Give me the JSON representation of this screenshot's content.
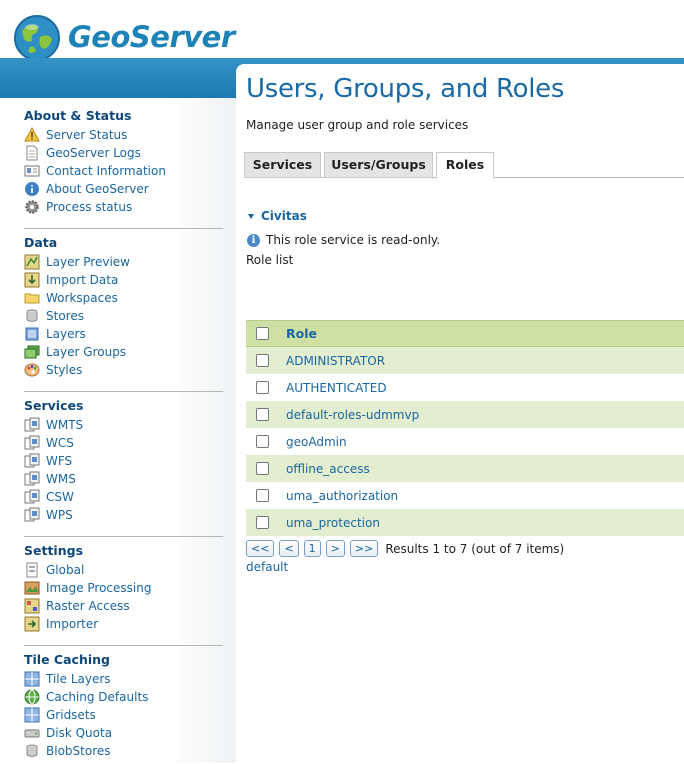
{
  "app": {
    "name": "GeoServer"
  },
  "sidebar": {
    "sections": [
      {
        "title": "About & Status",
        "items": [
          {
            "label": "Server Status",
            "icon": "warning-icon"
          },
          {
            "label": "GeoServer Logs",
            "icon": "document-icon"
          },
          {
            "label": "Contact Information",
            "icon": "contact-card-icon"
          },
          {
            "label": "About GeoServer",
            "icon": "info-circle-icon"
          },
          {
            "label": "Process status",
            "icon": "gear-icon"
          }
        ]
      },
      {
        "title": "Data",
        "items": [
          {
            "label": "Layer Preview",
            "icon": "map-preview-icon"
          },
          {
            "label": "Import Data",
            "icon": "import-icon"
          },
          {
            "label": "Workspaces",
            "icon": "folder-icon"
          },
          {
            "label": "Stores",
            "icon": "database-icon"
          },
          {
            "label": "Layers",
            "icon": "layer-icon"
          },
          {
            "label": "Layer Groups",
            "icon": "layer-group-icon"
          },
          {
            "label": "Styles",
            "icon": "palette-icon"
          }
        ]
      },
      {
        "title": "Services",
        "items": [
          {
            "label": "WMTS",
            "icon": "service-icon"
          },
          {
            "label": "WCS",
            "icon": "service-icon"
          },
          {
            "label": "WFS",
            "icon": "service-icon"
          },
          {
            "label": "WMS",
            "icon": "service-icon"
          },
          {
            "label": "CSW",
            "icon": "service-icon"
          },
          {
            "label": "WPS",
            "icon": "service-icon"
          }
        ]
      },
      {
        "title": "Settings",
        "items": [
          {
            "label": "Global",
            "icon": "settings-page-icon"
          },
          {
            "label": "Image Processing",
            "icon": "image-icon"
          },
          {
            "label": "Raster Access",
            "icon": "raster-icon"
          },
          {
            "label": "Importer",
            "icon": "importer-icon"
          }
        ]
      },
      {
        "title": "Tile Caching",
        "items": [
          {
            "label": "Tile Layers",
            "icon": "grid-icon"
          },
          {
            "label": "Caching Defaults",
            "icon": "globe-icon"
          },
          {
            "label": "Gridsets",
            "icon": "grid-icon"
          },
          {
            "label": "Disk Quota",
            "icon": "disk-icon"
          },
          {
            "label": "BlobStores",
            "icon": "database-icon"
          }
        ]
      }
    ]
  },
  "main": {
    "title": "Users, Groups, and Roles",
    "description": "Manage user group and role services",
    "tabs": [
      {
        "label": "Services",
        "active": false
      },
      {
        "label": "Users/Groups",
        "active": false
      },
      {
        "label": "Roles",
        "active": true
      }
    ],
    "service_name": "Civitas",
    "info_message": "This role service is read-only.",
    "role_list_label": "Role list",
    "table": {
      "header": "Role",
      "rows": [
        "ADMINISTRATOR",
        "AUTHENTICATED",
        "default-roles-udmmvp",
        "geoAdmin",
        "offline_access",
        "uma_authorization",
        "uma_protection"
      ]
    },
    "pager": {
      "first": "<<",
      "prev": "<",
      "page": "1",
      "next": ">",
      "last": ">>",
      "results": "Results 1 to 7 (out of 7 items)"
    },
    "default_link": "default"
  }
}
